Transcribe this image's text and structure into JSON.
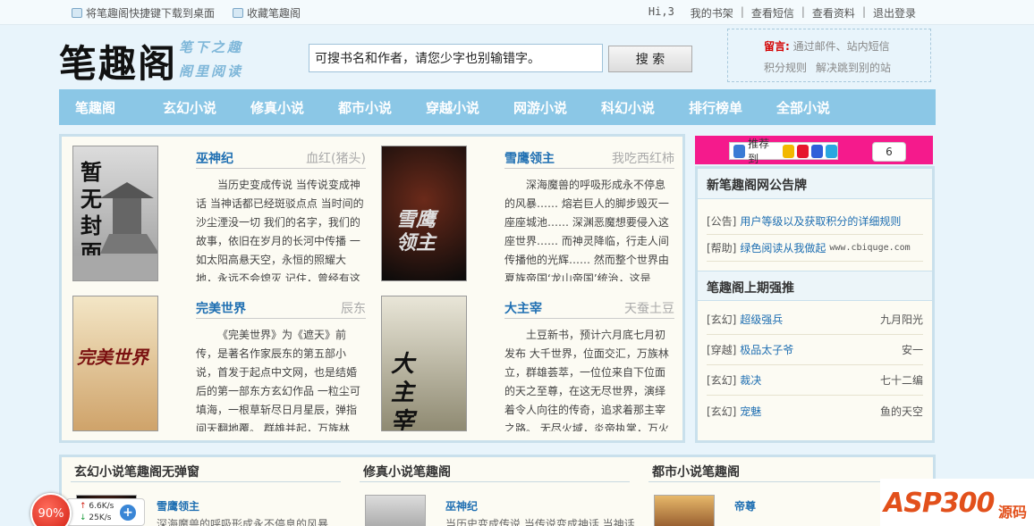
{
  "topbar": {
    "download": "将笔趣阁快捷键下载到桌面",
    "favorite": "收藏笔趣阁",
    "greeting": "Hi,3",
    "links": [
      "我的书架",
      "查看短信",
      "查看资料",
      "退出登录"
    ]
  },
  "header": {
    "logo": "笔趣阁",
    "slogan_line1": "笔下之趣",
    "slogan_line2": "阁里阅读",
    "search_value": "可搜书名和作者，请您少字也别输错字。",
    "search_button": "搜 索",
    "notice_label": "留言:",
    "notice_text": "通过邮件、站内短信",
    "notice_link1": "积分规则",
    "notice_link2": "解决跳到别的站"
  },
  "nav": [
    "笔趣阁",
    "玄幻小说",
    "修真小说",
    "都市小说",
    "穿越小说",
    "网游小说",
    "科幻小说",
    "排行榜单",
    "全部小说"
  ],
  "featured": [
    {
      "title": "巫神纪",
      "author": "血红(猪头)",
      "desc": "当历史变成传说 当传说变成神话 当神话都已经斑驳点点 当时间的沙尘湮没一切 我们的名字，我们的故事，依旧在岁月的长河中传播 一如太阳高悬天空，永恒的照耀大地，永远不会熄灭 记住，曾经有这",
      "cover_text": "暂无封面"
    },
    {
      "title": "雪鹰领主",
      "author": "我吃西红柿",
      "desc": "深海魔兽的呼吸形成永不停息的风暴…… 熔岩巨人的脚步毁灭一座座城池…… 深渊恶魔想要侵入这座世界…… 而神灵降临，行走人间传播他的光辉…… 然而整个世界由夏族帝国‘龙山帝国’统治，这是",
      "cover_text": "雪鹰领主"
    },
    {
      "title": "完美世界",
      "author": "辰东",
      "desc": "《完美世界》为《遮天》前传，是著名作家辰东的第五部小说，首发于起点中文网，也是结婚后的第一部东方玄幻作品 一粒尘可填海，一根草斩尽日月星辰，弹指间天翻地覆。 群雄并起，万族林",
      "cover_text": "完美世界"
    },
    {
      "title": "大主宰",
      "author": "天蚕土豆",
      "desc": "土豆新书，预计六月底七月初发布 大千世界，位面交汇，万族林立，群雄荟萃，一位位来自下位面的天之至尊，在这无尽世界，演绎着令人向往的传奇，追求着那主宰之路。 无尽火域，炎帝执掌，万火",
      "cover_text": "大主宰"
    }
  ],
  "share": {
    "label": "推荐到",
    "count": "6"
  },
  "announce": {
    "title": "新笔趣阁网公告牌",
    "items": [
      {
        "tag": "[公告]",
        "text": "用户等级以及获取积分的详细规则",
        "extra": ""
      },
      {
        "tag": "[帮助]",
        "text": "绿色阅读从我做起",
        "extra": "www.cbiquge.com"
      }
    ]
  },
  "ranking": {
    "title": "笔趣阁上期强推",
    "items": [
      {
        "tag": "[玄幻]",
        "book": "超级强兵",
        "author": "九月阳光"
      },
      {
        "tag": "[穿越]",
        "book": "极品太子爷",
        "author": "安一"
      },
      {
        "tag": "[玄幻]",
        "book": "裁决",
        "author": "七十二编"
      },
      {
        "tag": "[玄幻]",
        "book": "宠魅",
        "author": "鱼的天空"
      }
    ]
  },
  "columns": [
    {
      "title": "玄幻小说笔趣阁无弹窗",
      "book": "雪鹰领主",
      "desc": "深海魔兽的呼吸形成永不停息的风暴"
    },
    {
      "title": "修真小说笔趣阁",
      "book": "巫神纪",
      "desc": "当历史变成传说 当传说变成神话 当神话"
    },
    {
      "title": "都市小说笔趣阁",
      "book": "帝尊",
      "desc": ""
    }
  ],
  "speed": {
    "percent": "90%",
    "up": "6.6K/s",
    "down": "25K/s",
    "plus": "+"
  },
  "watermark": {
    "main": "ASP300",
    "suffix": "源码"
  },
  "colors": {
    "nav": "#8bc7e6",
    "link": "#1f6fb2",
    "share_bar": "#f51a8c",
    "notice_label": "#d40000"
  }
}
